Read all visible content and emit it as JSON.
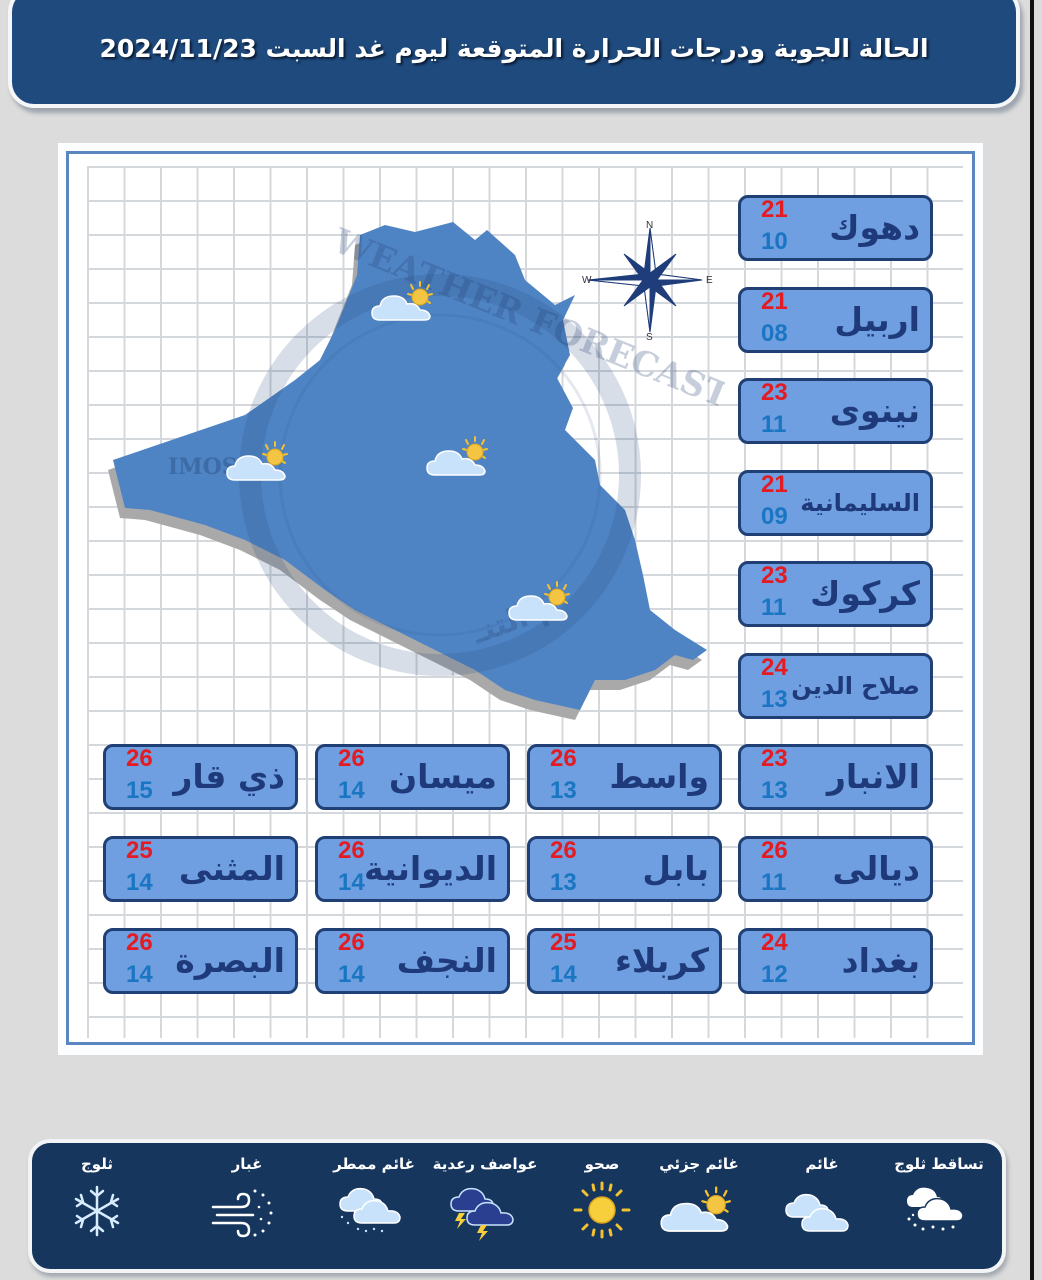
{
  "header": {
    "title": "الحالة الجوية ودرجات الحرارة المتوقعة ليوم غد السبت 2024/11/23"
  },
  "map": {
    "watermark_left": "IMOS",
    "watermark_arc": "WEATHER FORECASTING",
    "watermark_bottom": "م التنـ",
    "map_icon": "partly-cloudy",
    "map_icon_count": 4
  },
  "compass": {
    "n": "N",
    "s": "S",
    "e": "E",
    "w": "W"
  },
  "colors": {
    "header_bg": "#1f4a7e",
    "card_bg": "#6f9fe0",
    "card_border": "#1f3f75",
    "max_temp": "#e31b23",
    "min_temp": "#1a75c2",
    "legend_bg": "#16365e",
    "map_fill": "#4f84c4"
  },
  "provinces": [
    {
      "name": "دهوك",
      "max": "21",
      "min": "10"
    },
    {
      "name": "اربيل",
      "max": "21",
      "min": "08"
    },
    {
      "name": "نينوى",
      "max": "23",
      "min": "11"
    },
    {
      "name": "السليمانية",
      "max": "21",
      "min": "09"
    },
    {
      "name": "كركوك",
      "max": "23",
      "min": "11"
    },
    {
      "name": "صلاح الدين",
      "max": "24",
      "min": "13"
    },
    {
      "name": "الانبار",
      "max": "23",
      "min": "13"
    },
    {
      "name": "واسط",
      "max": "26",
      "min": "13"
    },
    {
      "name": "ميسان",
      "max": "26",
      "min": "14"
    },
    {
      "name": "ذي قار",
      "max": "26",
      "min": "15"
    },
    {
      "name": "ديالى",
      "max": "26",
      "min": "11"
    },
    {
      "name": "بابل",
      "max": "26",
      "min": "13"
    },
    {
      "name": "الديوانية",
      "max": "26",
      "min": "14"
    },
    {
      "name": "المثنى",
      "max": "25",
      "min": "14"
    },
    {
      "name": "بغداد",
      "max": "24",
      "min": "12"
    },
    {
      "name": "كربلاء",
      "max": "25",
      "min": "14"
    },
    {
      "name": "النجف",
      "max": "26",
      "min": "14"
    },
    {
      "name": "البصرة",
      "max": "26",
      "min": "14"
    }
  ],
  "legend": [
    {
      "label": "تساقط ثلوج",
      "icon": "snowfall-icon"
    },
    {
      "label": "غائم",
      "icon": "cloudy-icon"
    },
    {
      "label": "غائم جزئي",
      "icon": "partly-cloudy-icon"
    },
    {
      "label": "صحو",
      "icon": "sunny-icon"
    },
    {
      "label": "عواصف رعدية",
      "icon": "thunderstorm-icon"
    },
    {
      "label": "غائم ممطر",
      "icon": "rainy-cloud-icon"
    },
    {
      "label": "غبار",
      "icon": "dust-icon"
    },
    {
      "label": "ثلوج",
      "icon": "snowflake-icon"
    }
  ]
}
